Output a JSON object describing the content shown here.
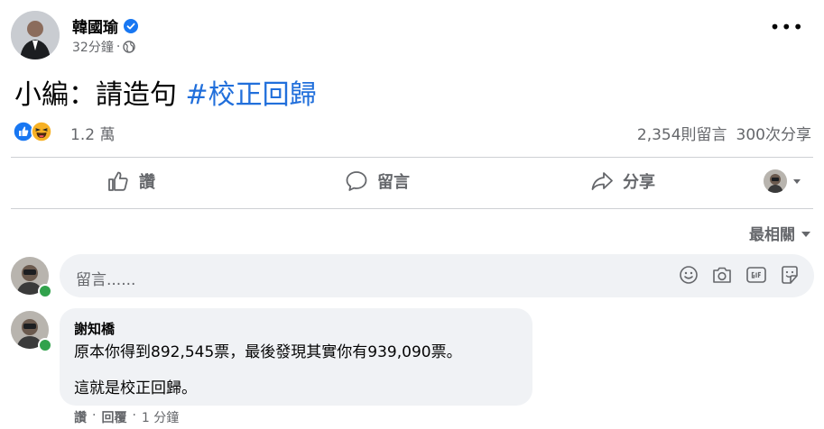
{
  "post": {
    "author": "韓國瑜",
    "time": "32分鐘",
    "text": "小編：請造句 ",
    "hashtag": "#校正回歸",
    "reaction_count": "1.2 萬",
    "comments_count": "2,354則留言",
    "shares_count": "300次分享"
  },
  "actions": {
    "like": "讚",
    "comment": "留言",
    "share": "分享"
  },
  "comments_section": {
    "sort_label": "最相關",
    "input_placeholder": "留言......"
  },
  "comment": {
    "author": "謝知橋",
    "line1": "原本你得到892,545票，最後發現其實你有939,090票。",
    "line2": "這就是校正回歸。",
    "like": "讚",
    "reply": "回覆",
    "time": "1 分鐘",
    "separator": "·"
  },
  "colors": {
    "hashtag": "#216fdb",
    "verified": "#1877f2",
    "online": "#31a24c",
    "like_reaction": "#1877f2",
    "haha_reaction": "#f7b125"
  }
}
